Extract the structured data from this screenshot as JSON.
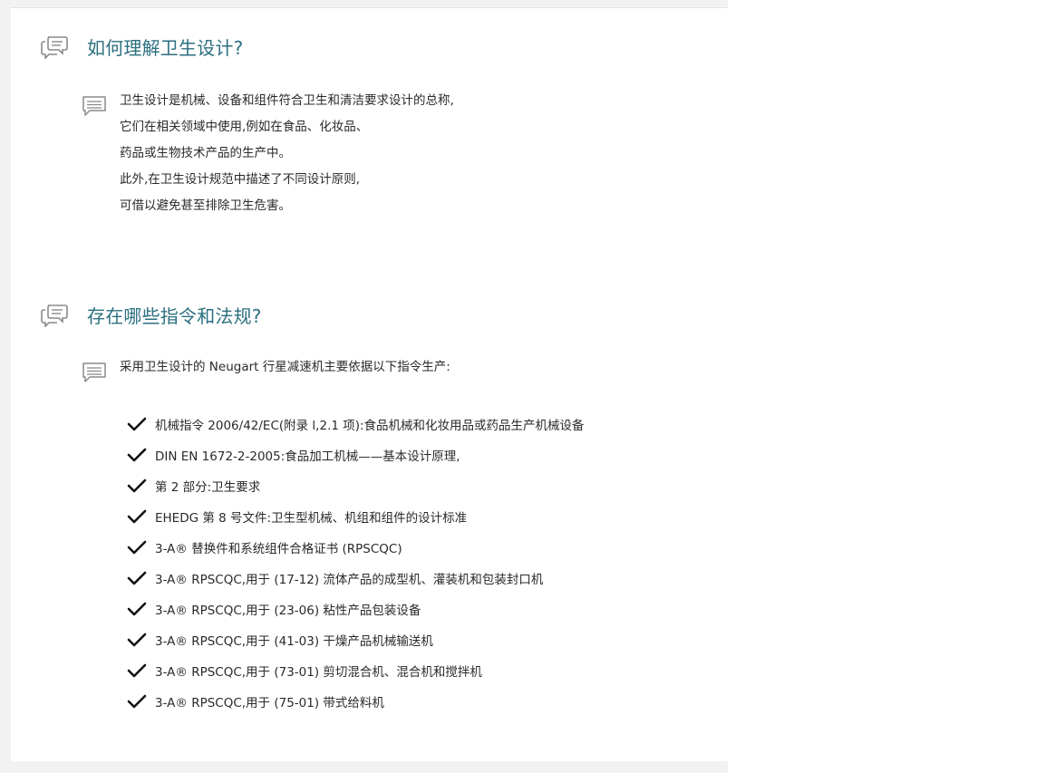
{
  "sections": [
    {
      "title": "如何理解卫生设计?",
      "paragraph": [
        "卫生设计是机械、设备和组件符合卫生和清洁要求设计的总称,",
        "它们在相关领域中使用,例如在食品、化妆品、",
        "药品或生物技术产品的生产中。",
        "此外,在卫生设计规范中描述了不同设计原则,",
        "可借以避免甚至排除卫生危害。"
      ]
    },
    {
      "title": "存在哪些指令和法规?",
      "intro": "采用卫生设计的 Neugart 行星减速机主要依据以下指令生产:",
      "items": [
        "机械指令 2006/42/EC(附录 l,2.1 项):食品机械和化妆用品或药品生产机械设备",
        "DIN EN 1672-2-2005:食品加工机械——基本设计原理,",
        "第 2 部分:卫生要求",
        "EHEDG 第 8 号文件:卫生型机械、机组和组件的设计标准",
        "3-A® 替换件和系统组件合格证书 (RPSCQC)",
        "3-A® RPSCQC,用于 (17-12) 流体产品的成型机、灌装机和包装封口机",
        "3-A® RPSCQC,用于 (23-06) 粘性产品包装设备",
        "3-A® RPSCQC,用于 (41-03) 干燥产品机械输送机",
        "3-A® RPSCQC,用于 (73-01) 剪切混合机、混合机和搅拌机",
        "3-A® RPSCQC,用于 (75-01) 带式给料机"
      ]
    }
  ],
  "colors": {
    "title": "#2b6f80",
    "icon": "#8a8a8a",
    "text": "#2a2a2a",
    "check": "#111111"
  },
  "icons": {
    "title_icon": "speech-bubbles-icon",
    "paragraph_icon": "comment-lines-icon",
    "check_icon": "checkmark-icon"
  }
}
